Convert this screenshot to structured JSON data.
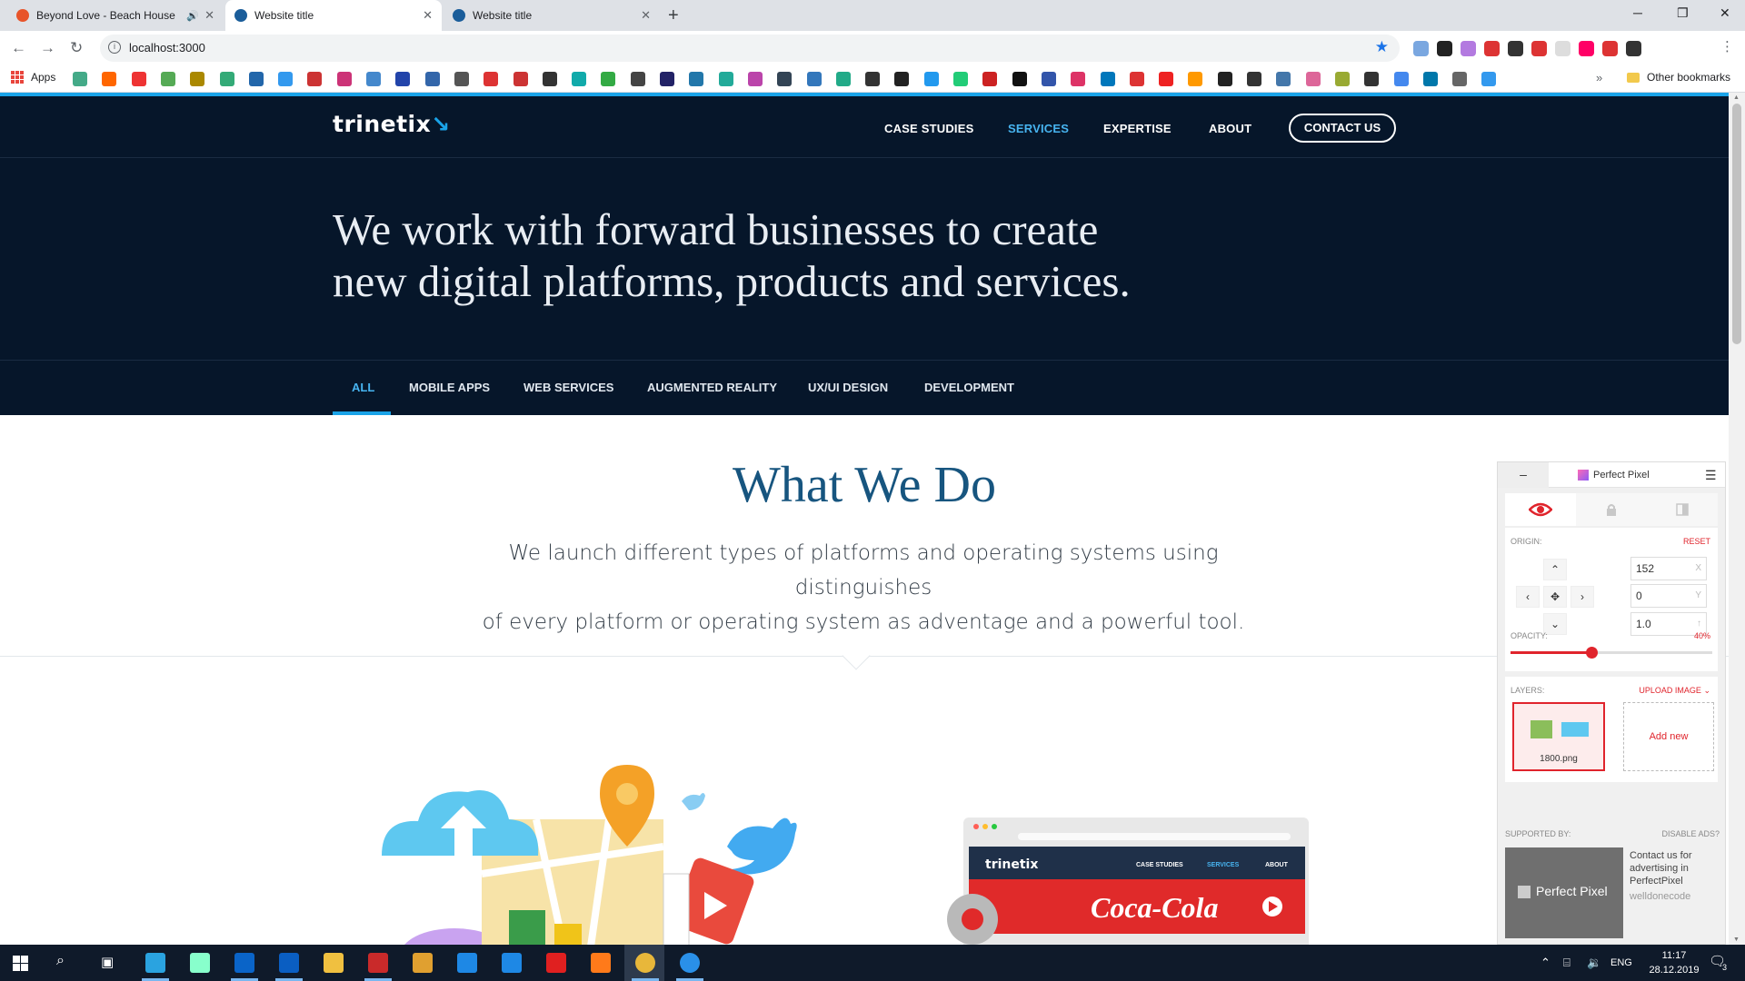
{
  "browser": {
    "tabs": [
      {
        "title": "Beyond Love - Beach House",
        "favicon_color": "#e8542a",
        "audio": true,
        "active": false
      },
      {
        "title": "Website title",
        "favicon_color": "#1a5d9a",
        "active": true
      },
      {
        "title": "Website title",
        "favicon_color": "#1a5d9a",
        "active": false
      }
    ],
    "address": "localhost:3000",
    "bookmarks": {
      "apps_label": "Apps",
      "other_label": "Other bookmarks"
    }
  },
  "site": {
    "logo": "trinetix",
    "nav": {
      "case_studies": "CASE STUDIES",
      "services": "SERVICES",
      "expertise": "EXPERTISE",
      "about": "ABOUT",
      "contact": "CONTACT US"
    },
    "hero": {
      "line1": "We work with forward businesses to create",
      "line2": "new digital platforms, products and services."
    },
    "filters": {
      "all": "ALL",
      "mobile": "MOBILE APPS",
      "web": "WEB SERVICES",
      "ar": "AUGMENTED REALITY",
      "uxui": "UX/UI DESIGN",
      "dev": "DEVELOPMENT"
    },
    "what_we_do": {
      "title": "What We Do",
      "desc_line1": "We launch different types of platforms and operating systems using distinguishes",
      "desc_line2": "of every platform or operating system as adventage and a powerful tool."
    },
    "illustration_right": {
      "logo": "trinetix",
      "nav_case": "CASE STUDIES",
      "nav_services": "SERVICES",
      "nav_about": "ABOUT",
      "banner": "Coca-Cola"
    }
  },
  "perfect_pixel": {
    "minimize": "–",
    "title": "Perfect Pixel",
    "origin_label": "ORIGIN:",
    "reset_label": "RESET",
    "x_value": "152",
    "x_suffix": "X",
    "y_value": "0",
    "y_suffix": "Y",
    "scale_value": "1.0",
    "opacity_label": "OPACITY:",
    "opacity_text": "40%",
    "opacity_value": 0.4,
    "layers_label": "LAYERS:",
    "upload_label": "UPLOAD IMAGE",
    "layer_name": "1800.png",
    "add_new": "Add new",
    "supported_by": "SUPPORTED BY:",
    "disable_ads": "DISABLE ADS?",
    "ad_brand": "Perfect Pixel",
    "ad_text": "Contact us for advertising in PerfectPixel",
    "ad_link": "welldonecode"
  },
  "taskbar": {
    "lang": "ENG",
    "time": "11:17",
    "date": "28.12.2019",
    "notifications": "3"
  }
}
